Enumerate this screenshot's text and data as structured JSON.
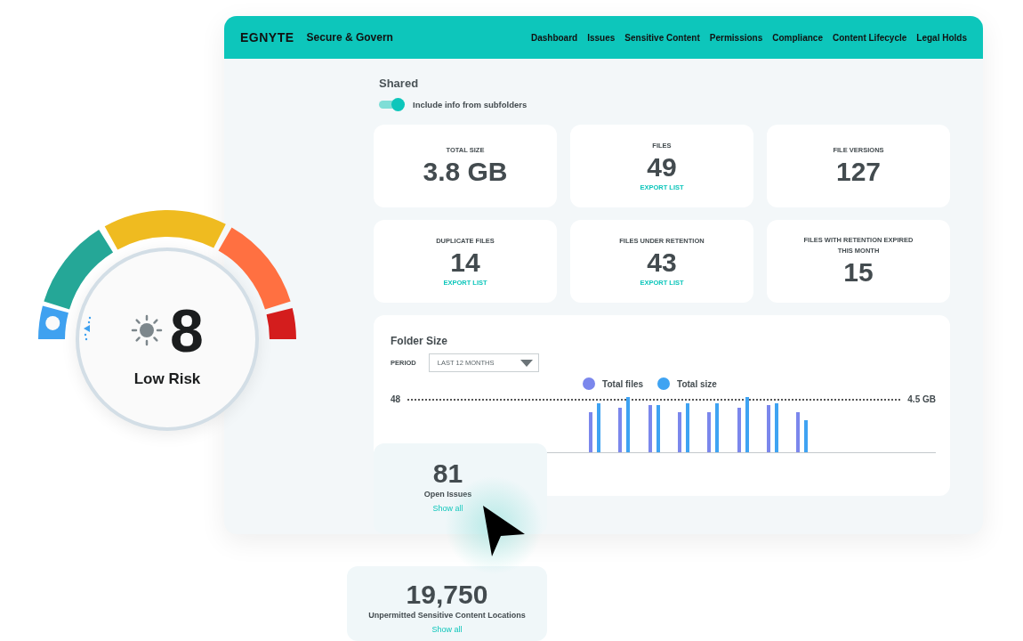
{
  "app": {
    "logo": "EGNYTE",
    "title": "Secure & Govern"
  },
  "nav": [
    {
      "label": "Dashboard"
    },
    {
      "label": "Issues"
    },
    {
      "label": "Sensitive Content"
    },
    {
      "label": "Permissions"
    },
    {
      "label": "Compliance"
    },
    {
      "label": "Content Lifecycle"
    },
    {
      "label": "Legal Holds"
    }
  ],
  "folder": {
    "title": "Shared",
    "toggle": {
      "label": "Include info from subfolders",
      "on": true
    }
  },
  "stats": [
    {
      "label": "TOTAL SIZE",
      "value": "3.8 GB"
    },
    {
      "label": "FILES",
      "value": "49",
      "action": "EXPORT LIST"
    },
    {
      "label": "FILE VERSIONS",
      "value": "127"
    },
    {
      "label": "DUPLICATE FILES",
      "value": "14",
      "action": "EXPORT LIST"
    },
    {
      "label": "FILES UNDER RETENTION",
      "value": "43",
      "action": "EXPORT LIST"
    },
    {
      "label": "FILES WITH RETENTION EXPIRED THIS MONTH",
      "value": "15"
    }
  ],
  "folder_size": {
    "title": "Folder Size",
    "period_label": "PERIOD",
    "period": "LAST 12 MONTHS",
    "legend": [
      {
        "name": "Total files",
        "color": "#7b87ec"
      },
      {
        "name": "Total size",
        "color": "#3fa3f2"
      }
    ],
    "left_max": "48",
    "right_max": "4.5 GB"
  },
  "risk": {
    "score": "8",
    "label": "Low Risk"
  },
  "issues": {
    "value": "81",
    "label": "Open Issues",
    "link": "Show all"
  },
  "sensitive": {
    "value": "19,750",
    "label": "Unpermitted Sensitive Content Locations",
    "link": "Show all"
  }
}
